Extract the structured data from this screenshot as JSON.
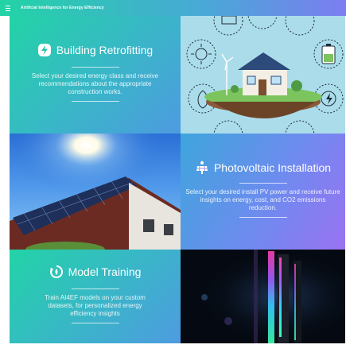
{
  "header": {
    "menu_icon": "hamburger-menu-icon",
    "title": "Artificial Intelligence for Energy Efficiency"
  },
  "cards": [
    {
      "icon": "bolt-icon",
      "title": "Building Retrofitting",
      "description": "Select your desired energy class and receive recommendations about the appropriate construction works."
    },
    {
      "icon": "solar-panel-icon",
      "title": "Photovoltaic Installation",
      "description": "Select your desired install PV power and receive future insights on energy, cost, and CO2 emissions reduction."
    },
    {
      "icon": "training-icon",
      "title": "Model Training",
      "description": "Train AI4EF models on your custom datasets, for personalized energy efficiency insights"
    }
  ],
  "colors": {
    "gradient_green": "#22d3a6",
    "gradient_blue": "#4e9be0",
    "gradient_purple": "#9a72f2"
  }
}
